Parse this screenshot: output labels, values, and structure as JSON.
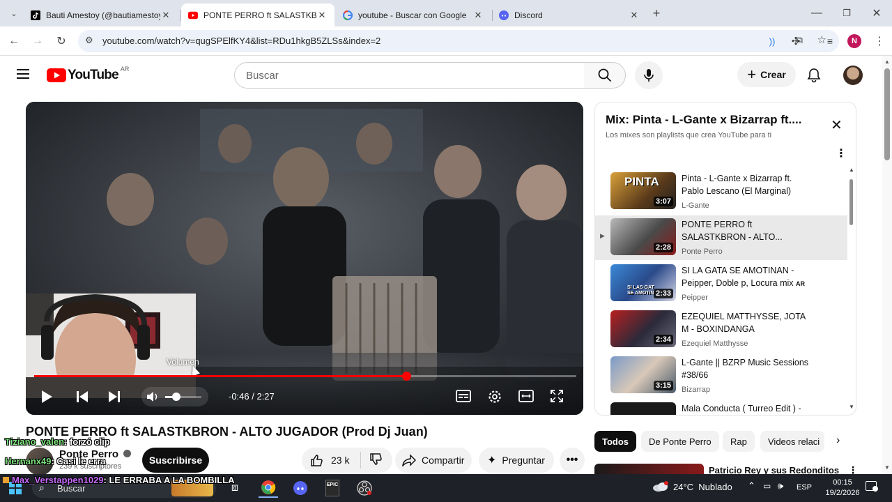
{
  "tabs": [
    {
      "label": "Bauti Amestoy (@bautiamestoy",
      "favicon": "tiktok-icon"
    },
    {
      "label": "PONTE PERRO ft SALASTKBRON",
      "favicon": "youtube-icon"
    },
    {
      "label": "youtube - Buscar con Google",
      "favicon": "google-icon"
    },
    {
      "label": "Discord",
      "favicon": "discord-icon"
    }
  ],
  "address": {
    "url": "youtube.com/watch?v=qugSPElfKY4&list=RDu1hkgB5ZLSs&index=2"
  },
  "profile_initial": "N",
  "youtube": {
    "logo_text": "YouTube",
    "country": "AR",
    "search_placeholder": "Buscar",
    "create_label": "Crear"
  },
  "player": {
    "tooltip": "Volumen",
    "time": "-0:46 / 2:27",
    "progress": 0.687,
    "volume": 0.3
  },
  "playlist": {
    "title": "Mix: Pinta - L-Gante x Bizarrap ft....",
    "subtitle": "Los mixes son playlists que crea YouTube para ti",
    "items": [
      {
        "title": "Pinta - L-Gante x Bizarrap ft. Pablo Lescano (El Marginal)",
        "channel": "L-Gante",
        "duration": "3:07",
        "thumb_text": "PINTA",
        "active": false
      },
      {
        "title": "PONTE PERRO ft SALASTKBRON - ALTO...",
        "channel": "Ponte Perro",
        "duration": "2:28",
        "thumb_text": "",
        "active": true
      },
      {
        "title": "SI LA GATA SE AMOTINAN - Peipper, Doble p, Locura mix",
        "title_badge": "AR",
        "channel": "Peipper",
        "duration": "2:33",
        "thumb_text": "SI LAS GAT SE AMOTIN",
        "active": false
      },
      {
        "title": "EZEQUIEL MATTHYSSE, JOTA M - BOXINDANGA",
        "channel": "Ezequiel Matthysse",
        "duration": "2:34",
        "thumb_text": "",
        "active": false
      },
      {
        "title": "L-Gante || BZRP Music Sessions #38/66",
        "channel": "Bizarrap",
        "duration": "3:15",
        "thumb_text": "",
        "active": false
      },
      {
        "title": "Mala Conducta ( Turreo Edit ) -",
        "channel": "",
        "duration": "",
        "thumb_text": "",
        "active": false
      }
    ]
  },
  "video": {
    "title": "PONTE PERRO ft SALASTKBRON - ALTO JUGADOR (Prod Dj Juan)",
    "channel": "Ponte Perro",
    "subscribers": "239 k suscriptores",
    "subscribe_label": "Suscribirse",
    "likes": "23 k",
    "share_label": "Compartir",
    "ask_label": "Preguntar"
  },
  "chips": [
    "Todos",
    "De Ponte Perro",
    "Rap",
    "Videos relaci"
  ],
  "next_video": {
    "title": "Patricio Rey y sus Redonditos"
  },
  "chat": [
    {
      "user": "Tiziano_valen",
      "message": ": forzó clip",
      "color": "#7ee37e"
    },
    {
      "user": "Hernanx49",
      "message": ": Casi le erra",
      "color": "#7ee37e"
    },
    {
      "user": "Max_Verstappen1029",
      "message": ": LE ERRABA A LA BOMBILLA",
      "color": "#c86bff"
    }
  ],
  "taskbar": {
    "search_label": "Buscar",
    "weather": "24°C  Nublado",
    "language": "ESP",
    "time": "00:15",
    "date": "19/2/2026"
  },
  "colors": {
    "accent_red": "#ff0000",
    "chrome_bg": "#dfe3eb",
    "taskbar": "#1e2228"
  }
}
